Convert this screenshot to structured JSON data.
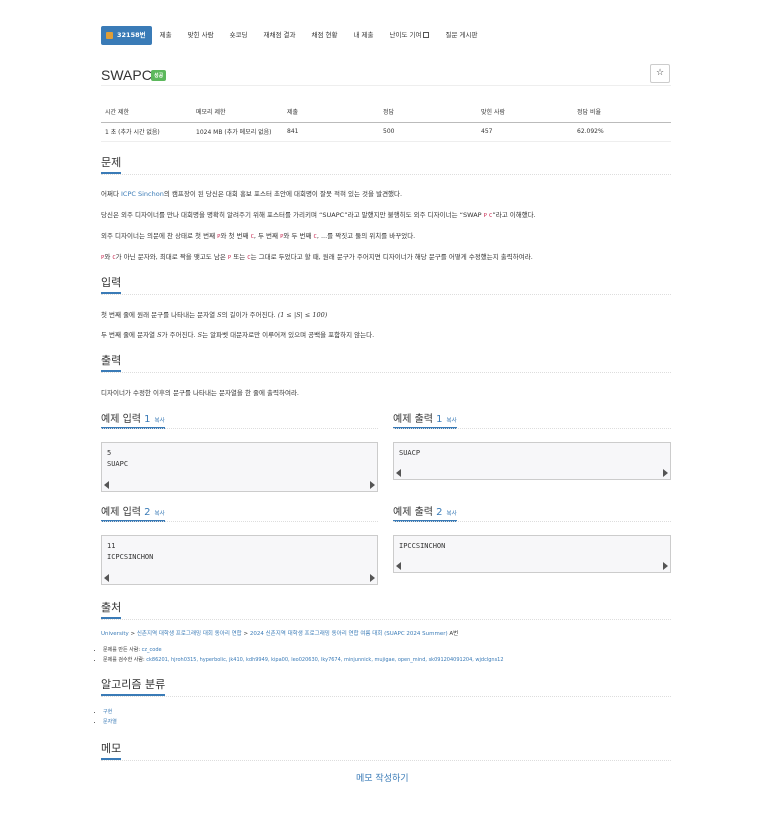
{
  "nav": {
    "problem_id": "32158번",
    "tabs": [
      "제출",
      "맞힌 사람",
      "숏코딩",
      "재채점 결과",
      "채점 현황",
      "내 제출",
      "난이도 기여",
      "질문 게시판"
    ]
  },
  "problem": {
    "title": "SWAPC",
    "badge": "성공",
    "star": "☆"
  },
  "info": {
    "headers": [
      "시간 제한",
      "메모리 제한",
      "제출",
      "정답",
      "맞힌 사람",
      "정답 비율"
    ],
    "values": [
      "1 초 (추가 시간 없음)",
      "1024 MB (추가 메모리 없음)",
      "841",
      "500",
      "457",
      "62.092%"
    ]
  },
  "sections": {
    "problem": "문제",
    "input": "입력",
    "output": "출력",
    "source": "출처",
    "algorithm": "알고리즘 분류",
    "memo": "메모"
  },
  "statement": {
    "l1a": "어쩌다 ",
    "l1b": "ICPC Sinchon",
    "l1c": "의 캠프장이 된 당신은 대회 홍보 포스터 초안에 대회명이 잘못 적혀 있는 것을 발견했다.",
    "l2a": "당신은 외주 디자이너를 만나 대회명을 명확히 알려주기 위해 포스터를 가리키며 “SUAPC”라고 말했지만 불행히도 외주 디자이너는 “SWAP ",
    "l2p": "P",
    "l2c": "C",
    "l2d": "”라고 이해했다.",
    "l3a": "외주 디자이너는 의문에 찬 상태로 첫 번째 ",
    "l3p": "P",
    "l3b": "와 첫 번째 ",
    "l3c": "C",
    "l3d": ", 두 번째 ",
    "l3e": "P",
    "l3f": "와 두 번째 ",
    "l3g": "C",
    "l3h": ", ...를 짝짓고 둘의 위치를 바꾸었다.",
    "l4p": "P",
    "l4a": "와 ",
    "l4c": "C",
    "l4b": "가 아닌 문자와, 최대로 짝을 맺고도 남은 ",
    "l4p2": "P",
    "l4d": " 또는 ",
    "l4c2": "C",
    "l4e": "는 그대로 두었다고 할 때, 원래 문구가 주어지면 디자이너가 해당 문구를 어떻게 수정했는지 출력하여라."
  },
  "input": {
    "l1a": "첫 번째 줄에 원래 문구를 나타내는 문자열 ",
    "l1s": "S",
    "l1b": "의 길이가 주어진다. ",
    "l1m": "(1 ≤ |S| ≤ 100)",
    "l2a": "두 번째 줄에 문자열 ",
    "l2s": "S",
    "l2b": "가 주어진다. ",
    "l2s2": "S",
    "l2c": "는 알파벳 대문자로만 이루어져 있으며 공백을 포함하지 않는다."
  },
  "output": {
    "l1": "디자이너가 수정한 이후의 문구를 나타내는 문자열을 한 줄에 출력하여라."
  },
  "samples": [
    {
      "label": "예제 입력 ",
      "num": "1",
      "copy": "복사",
      "text": "5\nSUAPC"
    },
    {
      "label": "예제 출력 ",
      "num": "1",
      "copy": "복사",
      "text": "SUACP"
    },
    {
      "label": "예제 입력 ",
      "num": "2",
      "copy": "복사",
      "text": "11\nICPCSINCHON"
    },
    {
      "label": "예제 출력 ",
      "num": "2",
      "copy": "복사",
      "text": "IPCCSINCHON"
    }
  ],
  "source": {
    "a": "University",
    "sep1": " > ",
    "b": "신촌지역 대학생 프로그래밍 대회 동아리 연합",
    "sep2": " > ",
    "c": "2024 신촌지역 대학생 프로그래밍 동아리 연합 여름 대회 (SUAPC 2024 Summer)",
    "d": " A번",
    "maker_label": "문제를 만든 사람: ",
    "maker": "cz_code",
    "reviewer_label": "문제를 검수한 사람: ",
    "reviewers": "ck86201, hjroh0315, hyperbolic, jk410, kdh9949, kipa00, leo020630, lky7674, minjunnick, mujigae, open_mind, sk091204091204, wjdclgns12"
  },
  "algorithm": {
    "items": [
      "구현",
      "문자열"
    ]
  },
  "memo": {
    "button": "메모 작성하기"
  }
}
